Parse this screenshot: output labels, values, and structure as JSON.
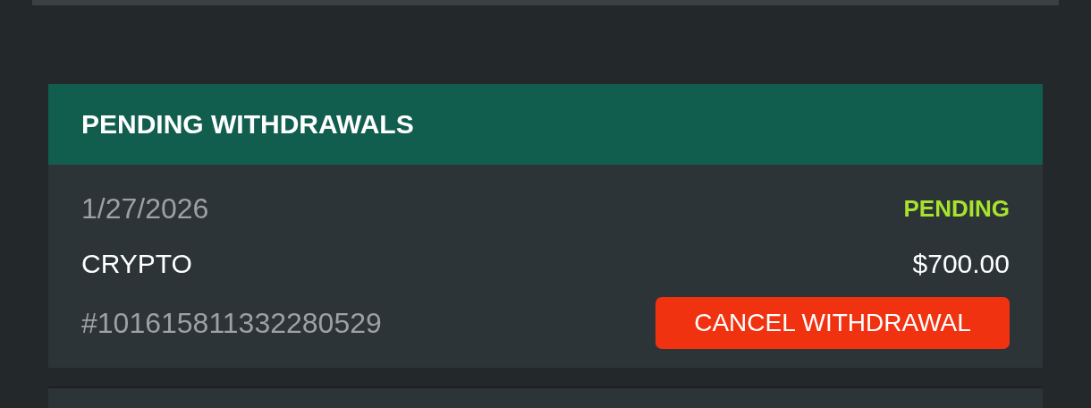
{
  "section": {
    "title": "PENDING WITHDRAWALS"
  },
  "withdrawals": [
    {
      "date": "1/27/2026",
      "status": "PENDING",
      "method": "CRYPTO",
      "amount": "$700.00",
      "reference": "#101615811332280529",
      "action": "CANCEL WITHDRAWAL"
    }
  ]
}
